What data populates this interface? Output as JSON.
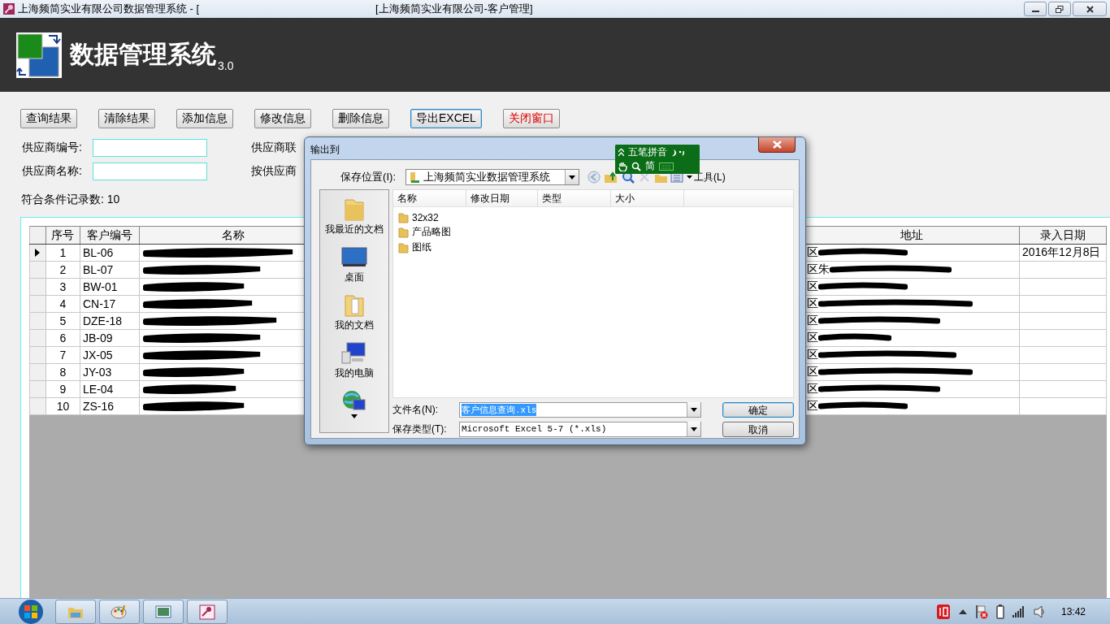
{
  "window": {
    "title_left": "上海频简实业有限公司数据管理系统 - [",
    "title_right": "[上海频简实业有限公司-客户管理]"
  },
  "header": {
    "title": "数据管理系统",
    "version": "3.0"
  },
  "toolbar": [
    {
      "label": "查询结果",
      "kind": "normal"
    },
    {
      "label": "清除结果",
      "kind": "normal"
    },
    {
      "label": "添加信息",
      "kind": "normal"
    },
    {
      "label": "修改信息",
      "kind": "normal"
    },
    {
      "label": "删除信息",
      "kind": "normal"
    },
    {
      "label": "导出EXCEL",
      "kind": "focused"
    },
    {
      "label": "关闭窗口",
      "kind": "danger"
    }
  ],
  "filters": [
    {
      "label": "供应商编号:",
      "side_label": "供应商联"
    },
    {
      "label": "供应商名称:",
      "side_label": "按供应商"
    }
  ],
  "record_count": "符合条件记录数: 10",
  "table": {
    "columns": [
      "序号",
      "客户编号",
      "名称",
      "地址",
      "录入日期"
    ],
    "rows": [
      {
        "selected": true,
        "no": "1",
        "code": "BL-06",
        "address": "区",
        "date": "2016年12月8日"
      },
      {
        "selected": false,
        "no": "2",
        "code": "BL-07",
        "address": "区朱"
      },
      {
        "selected": false,
        "no": "3",
        "code": "BW-01",
        "address": "区"
      },
      {
        "selected": false,
        "no": "4",
        "code": "CN-17",
        "address": "区"
      },
      {
        "selected": false,
        "no": "5",
        "code": "DZE-18",
        "address": "区"
      },
      {
        "selected": false,
        "no": "6",
        "code": "JB-09",
        "address": "区"
      },
      {
        "selected": false,
        "no": "7",
        "code": "JX-05",
        "address": "区"
      },
      {
        "selected": false,
        "no": "8",
        "code": "JY-03",
        "address": "区"
      },
      {
        "selected": false,
        "no": "9",
        "code": "LE-04",
        "address": "区"
      },
      {
        "selected": false,
        "no": "10",
        "code": "ZS-16",
        "address": "区"
      }
    ]
  },
  "dialog": {
    "title": "输出到",
    "save_in_label": "保存位置(I):",
    "save_in": "上海频简实业数据管理系统",
    "tools": "工具(L)",
    "places": [
      {
        "kind": "recent",
        "label": "我最近的文档"
      },
      {
        "kind": "desktop",
        "label": "桌面"
      },
      {
        "kind": "documents",
        "label": "我的文档"
      },
      {
        "kind": "computer",
        "label": "我的电脑"
      },
      {
        "kind": "network"
      }
    ],
    "columns": [
      "名称",
      "修改日期",
      "类型",
      "大小"
    ],
    "files": [
      "32x32",
      "产品略图",
      "图纸"
    ],
    "filename_label": "文件名(N):",
    "filename": "客户信息查询.xls",
    "filename_selected": true,
    "filetype_label": "保存类型(T):",
    "filetype": "Microsoft Excel 5-7 (*.xls)",
    "buttons": [
      "确定",
      "取消"
    ]
  },
  "ime": {
    "mode": "五笔拼音",
    "charset": "简"
  },
  "taskbar": {
    "time": "13:42"
  }
}
